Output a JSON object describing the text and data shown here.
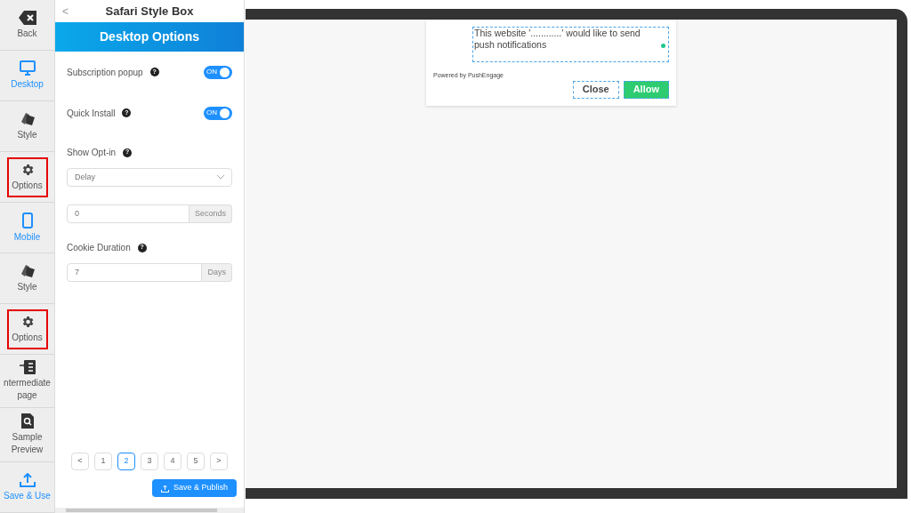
{
  "rail": [
    {
      "kind": "back",
      "label": "Back",
      "selected": false,
      "highlighted": false
    },
    {
      "kind": "desktop",
      "label": "Desktop",
      "selected": true,
      "highlighted": false
    },
    {
      "kind": "style",
      "label": "Style",
      "selected": false,
      "highlighted": false
    },
    {
      "kind": "options",
      "label": "Options",
      "selected": false,
      "highlighted": true
    },
    {
      "kind": "mobile",
      "label": "Mobile",
      "selected": true,
      "highlighted": false
    },
    {
      "kind": "style",
      "label": "Style",
      "selected": false,
      "highlighted": false
    },
    {
      "kind": "options",
      "label": "Options",
      "selected": false,
      "highlighted": true
    },
    {
      "kind": "intermediate",
      "label": "ntermediate page",
      "selected": false,
      "highlighted": false
    },
    {
      "kind": "preview",
      "label": "Sample Preview",
      "selected": false,
      "highlighted": false
    },
    {
      "kind": "save",
      "label": "Save & Use",
      "selected": true,
      "highlighted": false
    }
  ],
  "panel": {
    "back": "<",
    "title": "Safari Style Box",
    "banner": "Desktop Options",
    "settings": [
      {
        "kind": "toggle",
        "label": "Subscription popup",
        "help": "?",
        "on": true,
        "on_text": "ON"
      },
      {
        "kind": "toggle",
        "label": "Quick Install",
        "help": "?",
        "on": true,
        "on_text": "ON"
      },
      {
        "kind": "select",
        "label": "Show Opt-in",
        "help": "?",
        "value": "Delay"
      },
      {
        "kind": "input",
        "value": "0",
        "addon": "Seconds"
      },
      {
        "kind": "input",
        "label": "Cookie Duration",
        "help": "?",
        "value": "7",
        "addon": "Days"
      }
    ],
    "pagination": [
      {
        "label": "<",
        "selected": false
      },
      {
        "label": "1",
        "selected": false
      },
      {
        "label": "2",
        "selected": true
      },
      {
        "label": "3",
        "selected": false
      },
      {
        "label": "4",
        "selected": false
      },
      {
        "label": "5",
        "selected": false
      },
      {
        "label": ">",
        "selected": false
      }
    ],
    "save_button": "Save & Publish"
  },
  "preview": {
    "message": "This website '............' would like to send push notifications",
    "powered_by": "Powered by PushEngage",
    "buttons": [
      "Close",
      "Allow"
    ]
  }
}
